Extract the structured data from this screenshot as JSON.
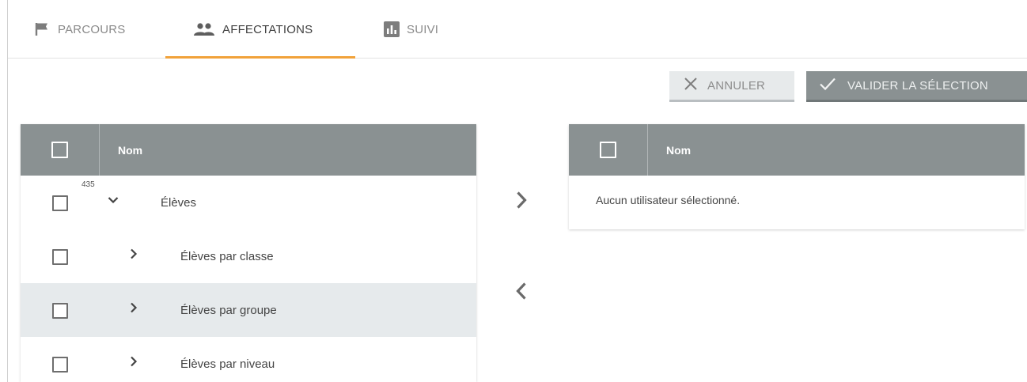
{
  "tabs": [
    {
      "label": "PARCOURS",
      "icon": "flag-icon",
      "active": false
    },
    {
      "label": "AFFECTATIONS",
      "icon": "people-icon",
      "active": true
    },
    {
      "label": "SUIVI",
      "icon": "bar-chart-icon",
      "active": false
    }
  ],
  "colors": {
    "accent": "#f1a23a",
    "header_bg": "#8a9192",
    "row_highlight": "#e6eaec"
  },
  "actions": {
    "cancel_label": "ANNULER",
    "cancel_icon": "close-icon",
    "validate_label": "VALIDER LA SÉLECTION",
    "validate_icon": "check-icon"
  },
  "left_table": {
    "header": "Nom",
    "rows": [
      {
        "label": "Élèves",
        "count": "435",
        "expanded": true
      },
      {
        "label": "Élèves par classe",
        "expanded": false
      },
      {
        "label": "Élèves par groupe",
        "expanded": false,
        "highlighted": true
      },
      {
        "label": "Élèves par niveau",
        "expanded": false
      }
    ]
  },
  "transfer": {
    "right_icon": "chevron-right-icon",
    "left_icon": "chevron-left-icon"
  },
  "right_table": {
    "header": "Nom",
    "empty_message": "Aucun utilisateur sélectionné."
  }
}
